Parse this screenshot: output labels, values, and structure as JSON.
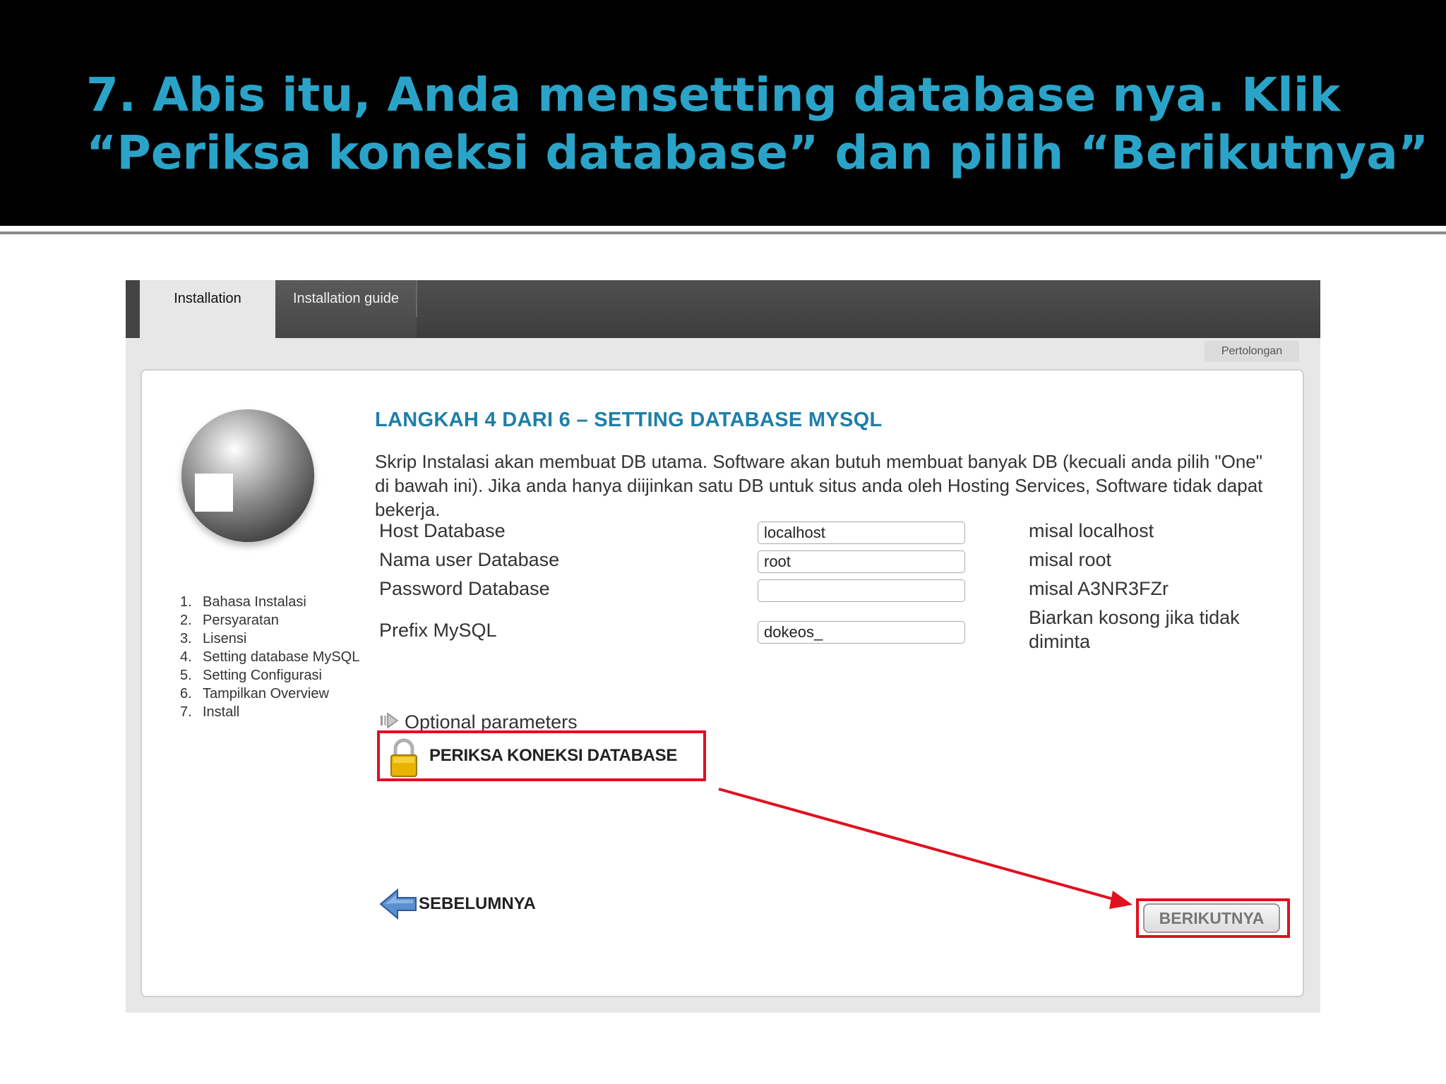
{
  "slide": {
    "title_line1": "7. Abis itu, Anda mensetting database nya. Klik",
    "title_line2": "“Periksa koneksi database” dan pilih “Berikutnya”"
  },
  "tabs": [
    {
      "label": "Installation",
      "active": true
    },
    {
      "label": "Installation guide",
      "active": false
    }
  ],
  "help_link": "Pertolongan",
  "steps": [
    {
      "num": "1.",
      "label": "Bahasa Instalasi"
    },
    {
      "num": "2.",
      "label": "Persyaratan"
    },
    {
      "num": "3.",
      "label": "Lisensi"
    },
    {
      "num": "4.",
      "label": "Setting database MySQL"
    },
    {
      "num": "5.",
      "label": "Setting Configurasi"
    },
    {
      "num": "6.",
      "label": "Tampilkan Overview"
    },
    {
      "num": "7.",
      "label": "Install"
    }
  ],
  "main": {
    "heading": "LANGKAH 4 DARI 6 – SETTING DATABASE MYSQL",
    "intro": "Skrip Instalasi akan membuat DB utama. Software akan butuh membuat banyak DB (kecuali anda pilih \"One\" di bawah ini). Jika anda hanya diijinkan satu DB untuk situs anda oleh Hosting Services, Software tidak dapat bekerja."
  },
  "form": {
    "host": {
      "label": "Host Database",
      "value": "localhost",
      "hint": "misal localhost"
    },
    "user": {
      "label": "Nama user Database",
      "value": "root",
      "hint": "misal root"
    },
    "password": {
      "label": "Password Database",
      "value": "",
      "hint": "misal A3NR3FZr"
    },
    "prefix": {
      "label": "Prefix MySQL",
      "value": "dokeos_",
      "hint": "Biarkan kosong jika tidak diminta"
    }
  },
  "optional_parameters": "Optional parameters",
  "check_button": "PERIKSA KONEKSI DATABASE",
  "prev_button": "SEBELUMNYA",
  "next_button": "BERIKUTNYA",
  "colors": {
    "title": "#2aa3c8",
    "heading": "#1e7fa8",
    "highlight": "#e01020"
  },
  "icons": {
    "lock": "padlock-icon",
    "prev": "arrow-left-icon",
    "optional": "arrow-right-small-icon"
  }
}
